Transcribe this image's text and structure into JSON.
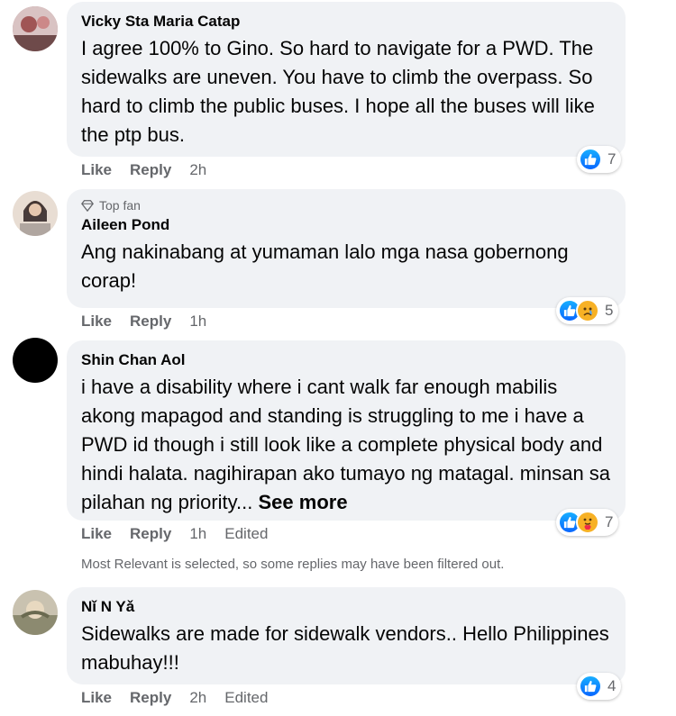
{
  "comments": [
    {
      "author": "Vicky Sta Maria Catap",
      "text": "I agree 100% to Gino. So hard to navigate for a PWD. The sidewalks are uneven. You have to climb the overpass. So hard to climb the public buses. I hope all the buses will like the ptp bus.",
      "like_label": "Like",
      "reply_label": "Reply",
      "time": "2h",
      "reaction_count": "7",
      "reactions": [
        "like"
      ],
      "avatar_color": "#b88a8a"
    },
    {
      "badge": "Top fan",
      "author": "Aileen Pond",
      "text": "Ang nakinabang at yumaman lalo mga nasa gobernong corap!",
      "like_label": "Like",
      "reply_label": "Reply",
      "time": "1h",
      "reaction_count": "5",
      "reactions": [
        "like",
        "sad"
      ],
      "avatar_color": "#c9b7a8"
    },
    {
      "author": "Shin Chan Aol",
      "text": "i have a disability where i cant walk far enough mabilis akong mapagod and standing is struggling to me i have a PWD id though i still look like a complete physical body and hindi halata. nagihirapan ako tumayo ng matagal. minsan sa pilahan ng priority...",
      "see_more": "See more",
      "like_label": "Like",
      "reply_label": "Reply",
      "time": "1h",
      "edited": "Edited",
      "reaction_count": "7",
      "reactions": [
        "like",
        "care"
      ],
      "avatar_color": "#000000"
    },
    {
      "author": "Nǐ N Yǎ",
      "text": "Sidewalks are made for sidewalk vendors.. Hello Philippines mabuhay!!!",
      "like_label": "Like",
      "reply_label": "Reply",
      "time": "2h",
      "edited": "Edited",
      "reaction_count": "4",
      "reactions": [
        "like"
      ],
      "avatar_color": "#b5a890"
    }
  ],
  "filter_notice": "Most Relevant is selected, so some replies may have been filtered out.",
  "colors": {
    "bubble": "#f0f2f5",
    "meta": "#65676b",
    "like_blue": "#0866ff"
  }
}
